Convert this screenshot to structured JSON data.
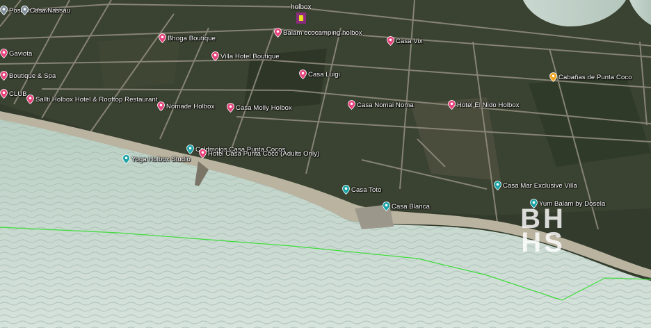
{
  "map": {
    "town_label": "holbox",
    "watermark": [
      "BH",
      "HS"
    ],
    "colors": {
      "pin_pink": "#e8417b",
      "pin_teal": "#1aa3a6",
      "pin_orange": "#f2a21a",
      "pin_grey": "#7d8c99",
      "sea": "#c5d6cc",
      "route_line": "#3fdc3a"
    },
    "pois": [
      {
        "label": "Posada Mawimbi",
        "icon": "pin-grey"
      },
      {
        "label": "Casa Nassau",
        "icon": "pin-grey"
      },
      {
        "label": "Bhoga Boutique",
        "icon": "pin-pink"
      },
      {
        "label": "Balam ecocamping holbox",
        "icon": "pin-pink"
      },
      {
        "label": "Casa Vix",
        "icon": "pin-pink"
      },
      {
        "label": "Villa Hotel Boutique",
        "icon": "pin-pink"
      },
      {
        "label": "Gaviota",
        "icon": "pin-pink"
      },
      {
        "label": "Boutique & Spa",
        "icon": "pin-pink"
      },
      {
        "label": "Casa Luigi",
        "icon": "pin-pink"
      },
      {
        "label": "Cabañas de Punta Coco",
        "icon": "pin-orange"
      },
      {
        "label": "CLUB",
        "icon": "pin-pink"
      },
      {
        "label": "Sallti Holbox Hotel & Rooftop Restaurant",
        "icon": "pin-pink"
      },
      {
        "label": "Nómade Holbox",
        "icon": "pin-pink"
      },
      {
        "label": "Casa Molly Holbox",
        "icon": "pin-pink"
      },
      {
        "label": "Casa Nomai Noma",
        "icon": "pin-pink"
      },
      {
        "label": "Hotel El Nido Holbox",
        "icon": "pin-pink"
      },
      {
        "label": "Coldmojos Casa Punta Cocos",
        "icon": "pin-teal"
      },
      {
        "label": "Yoga Holbox Studio",
        "icon": "pin-teal"
      },
      {
        "label": "Hotel Casa Punta Coco (Adults Only)",
        "icon": "pin-pink"
      },
      {
        "label": "Casa Mar Exclusive Villa",
        "icon": "pin-teal"
      },
      {
        "label": "Casa Toto",
        "icon": "pin-teal"
      },
      {
        "label": "Casa Blanca",
        "icon": "pin-teal"
      },
      {
        "label": "Yum Balam by Dosela",
        "icon": "pin-teal"
      }
    ]
  }
}
